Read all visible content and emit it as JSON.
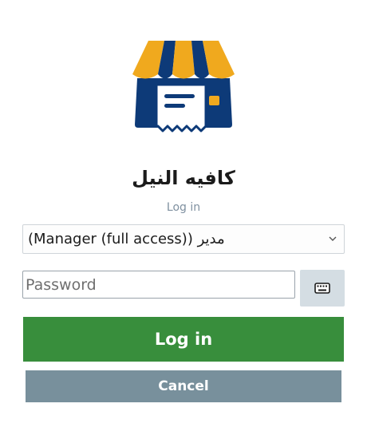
{
  "app": {
    "shop_name": "كافيه النيل",
    "subtitle": "Log in"
  },
  "colors": {
    "awning_yellow": "#f0a91e",
    "awning_navy": "#0d3a78",
    "login_green": "#388e3c",
    "cancel_gray": "#78909c",
    "keyboard_bg": "#d4dde3"
  },
  "form": {
    "role_selected": "مدير   (Manager (full access))",
    "password_placeholder": "Password",
    "password_value": "",
    "keyboard_icon": "keyboard-icon",
    "login_label": "Log in",
    "cancel_label": "Cancel"
  }
}
